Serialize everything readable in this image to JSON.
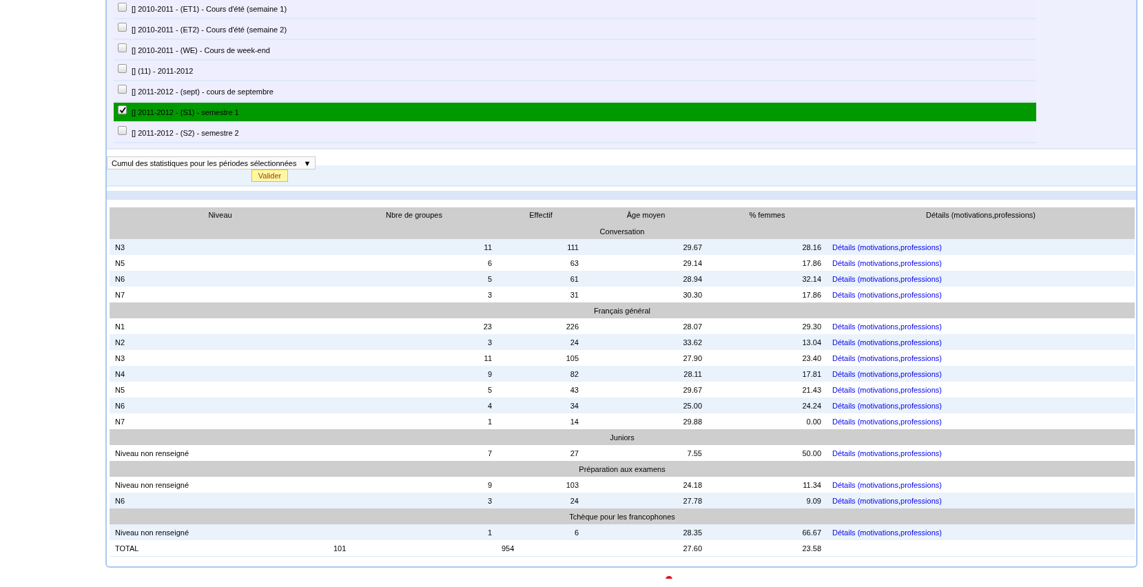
{
  "periods": [
    {
      "label": "[] 2010-2011 - (ET1) - Cours d'été (semaine 1)",
      "checked": false
    },
    {
      "label": "[] 2010-2011 - (ET2) - Cours d'été (semaine 2)",
      "checked": false
    },
    {
      "label": "[] 2010-2011 - (WE) - Cours de week-end",
      "checked": false
    },
    {
      "label": "[] (11) - 2011-2012",
      "checked": false
    },
    {
      "label": "[] 2011-2012 - (sept) - cours de septembre",
      "checked": false
    },
    {
      "label": "[] 2011-2012 - (S1) - semestre 1",
      "checked": true
    },
    {
      "label": "[] 2011-2012 - (S2) - semestre 2",
      "checked": false
    }
  ],
  "form": {
    "select_value": "Cumul des statistiques pour les périodes sélectionnées",
    "select_arrow": "▼",
    "button": "Valider"
  },
  "table": {
    "columns": [
      "Niveau",
      "Nbre de groupes",
      "Effectif",
      "Âge moyen",
      "% femmes",
      "Détails (motivations,professions)"
    ],
    "groups": [
      {
        "name": "Conversation",
        "rows": [
          {
            "niveau": "N3",
            "groupes": "11",
            "effectif": "111",
            "age": "29.67",
            "femmes": "28.16",
            "link": "Détails (motivations,professions)"
          },
          {
            "niveau": "N5",
            "groupes": "6",
            "effectif": "63",
            "age": "29.14",
            "femmes": "17.86",
            "link": "Détails (motivations,professions)"
          },
          {
            "niveau": "N6",
            "groupes": "5",
            "effectif": "61",
            "age": "28.94",
            "femmes": "32.14",
            "link": "Détails (motivations,professions)"
          },
          {
            "niveau": "N7",
            "groupes": "3",
            "effectif": "31",
            "age": "30.30",
            "femmes": "17.86",
            "link": "Détails (motivations,professions)"
          }
        ]
      },
      {
        "name": "Français général",
        "rows": [
          {
            "niveau": "N1",
            "groupes": "23",
            "effectif": "226",
            "age": "28.07",
            "femmes": "29.30",
            "link": "Détails (motivations,professions)"
          },
          {
            "niveau": "N2",
            "groupes": "3",
            "effectif": "24",
            "age": "33.62",
            "femmes": "13.04",
            "link": "Détails (motivations,professions)"
          },
          {
            "niveau": "N3",
            "groupes": "11",
            "effectif": "105",
            "age": "27.90",
            "femmes": "23.40",
            "link": "Détails (motivations,professions)"
          },
          {
            "niveau": "N4",
            "groupes": "9",
            "effectif": "82",
            "age": "28.11",
            "femmes": "17.81",
            "link": "Détails (motivations,professions)"
          },
          {
            "niveau": "N5",
            "groupes": "5",
            "effectif": "43",
            "age": "29.67",
            "femmes": "21.43",
            "link": "Détails (motivations,professions)"
          },
          {
            "niveau": "N6",
            "groupes": "4",
            "effectif": "34",
            "age": "25.00",
            "femmes": "24.24",
            "link": "Détails (motivations,professions)"
          },
          {
            "niveau": "N7",
            "groupes": "1",
            "effectif": "14",
            "age": "29.88",
            "femmes": "0.00",
            "link": "Détails (motivations,professions)"
          }
        ]
      },
      {
        "name": "Juniors",
        "rows": [
          {
            "niveau": "Niveau non renseigné",
            "groupes": "7",
            "effectif": "27",
            "age": "7.55",
            "femmes": "50.00",
            "link": "Détails (motivations,professions)"
          }
        ]
      },
      {
        "name": "Préparation aux examens",
        "rows": [
          {
            "niveau": "Niveau non renseigné",
            "groupes": "9",
            "effectif": "103",
            "age": "24.18",
            "femmes": "11.34",
            "link": "Détails (motivations,professions)"
          },
          {
            "niveau": "N6",
            "groupes": "3",
            "effectif": "24",
            "age": "27.78",
            "femmes": "9.09",
            "link": "Détails (motivations,professions)"
          }
        ]
      },
      {
        "name": "Tchèque pour les francophones",
        "rows": [
          {
            "niveau": "Niveau non renseigné",
            "groupes": "1",
            "effectif": "6",
            "age": "28.35",
            "femmes": "66.67",
            "link": "Détails (motivations,professions)"
          }
        ]
      }
    ],
    "total": {
      "niveau": "TOTAL",
      "groupes": "101",
      "effectif": "954",
      "age": "27.60",
      "femmes": "23.58"
    }
  }
}
